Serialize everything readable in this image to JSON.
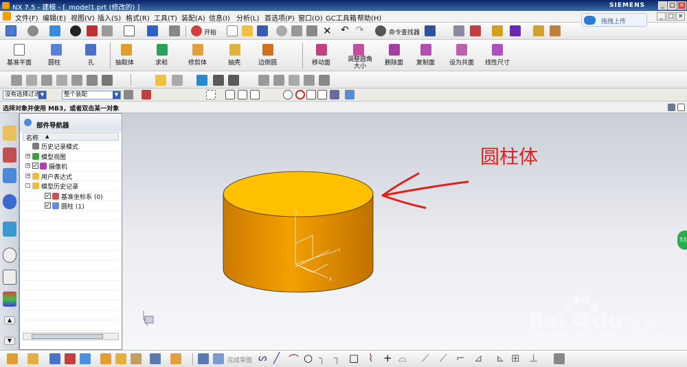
{
  "window": {
    "title": "NX 7.5 - 建模 - [_model1.prt  (修改的) ]",
    "brand": "SIEMENS",
    "controls": [
      "_",
      "□",
      "×"
    ]
  },
  "menubar": {
    "items": [
      "文件(F)",
      "编辑(E)",
      "视图(V)",
      "插入(S)",
      "格式(R)",
      "工具(T)",
      "装配(A)",
      "信息(I)",
      "分析(L)",
      "首选项(P)",
      "窗口(O)",
      "GC工具箱",
      "帮助(H)"
    ]
  },
  "upload_button": {
    "label": "拖拽上传"
  },
  "toolbar1": {
    "start_label": "开始",
    "command_finder_label": "命令查找器"
  },
  "feature_toolbar": {
    "items": [
      "基准平面",
      "圆柱",
      "孔",
      "抽取体",
      "求和",
      "修剪体",
      "抽壳",
      "边倒圆",
      "移动面",
      "调整圆角大小",
      "删除面",
      "复制面",
      "设为共面",
      "线性尺寸"
    ]
  },
  "selection_bar": {
    "filter": "没有选择过滤器",
    "scope": "整个装配"
  },
  "status": {
    "prompt": "选择对象并使用 MB3，或者双击某一对象"
  },
  "navigator": {
    "title": "部件导航器",
    "column_header": "名称",
    "rows": [
      {
        "label": "历史记录模式",
        "indent": 0,
        "expander": "",
        "checked": false,
        "icon": "history-icon",
        "icon_color": "#7a7a7a"
      },
      {
        "label": "模型视图",
        "indent": 0,
        "expander": "+",
        "checked": false,
        "icon": "model-views-icon",
        "icon_color": "#3aa04a"
      },
      {
        "label": "摄像机",
        "indent": 0,
        "expander": "+",
        "checked": true,
        "icon": "camera-icon",
        "icon_color": "#b040b0"
      },
      {
        "label": "用户表达式",
        "indent": 0,
        "expander": "+",
        "checked": false,
        "icon": "folder-icon",
        "icon_color": "#e8c040"
      },
      {
        "label": "模型历史记录",
        "indent": 0,
        "expander": "-",
        "checked": false,
        "icon": "folder-open-icon",
        "icon_color": "#e8c040"
      },
      {
        "label": "基准坐标系 (0)",
        "indent": 1,
        "expander": "",
        "checked": true,
        "icon": "datum-csys-icon",
        "icon_color": "#d05050"
      },
      {
        "label": "圆柱 (1)",
        "indent": 1,
        "expander": "",
        "checked": true,
        "icon": "cylinder-icon",
        "icon_color": "#6a8ae0"
      }
    ]
  },
  "viewport": {
    "annotation": "圆柱体",
    "annotation_color": "#e0201c",
    "cylinder_top_color": "#ffc000",
    "cylinder_side_color": "#e08a00",
    "axis_labels": [
      "Z",
      "Y",
      "X"
    ]
  },
  "bottom_toolbar": {
    "finish_sketch_label": "完成草图"
  },
  "watermark": {
    "brand": "Bai",
    "brand2": "du",
    "chinese": "经验",
    "url": "jingyan.baidu.com"
  },
  "side_bubble": {
    "label": "53"
  }
}
